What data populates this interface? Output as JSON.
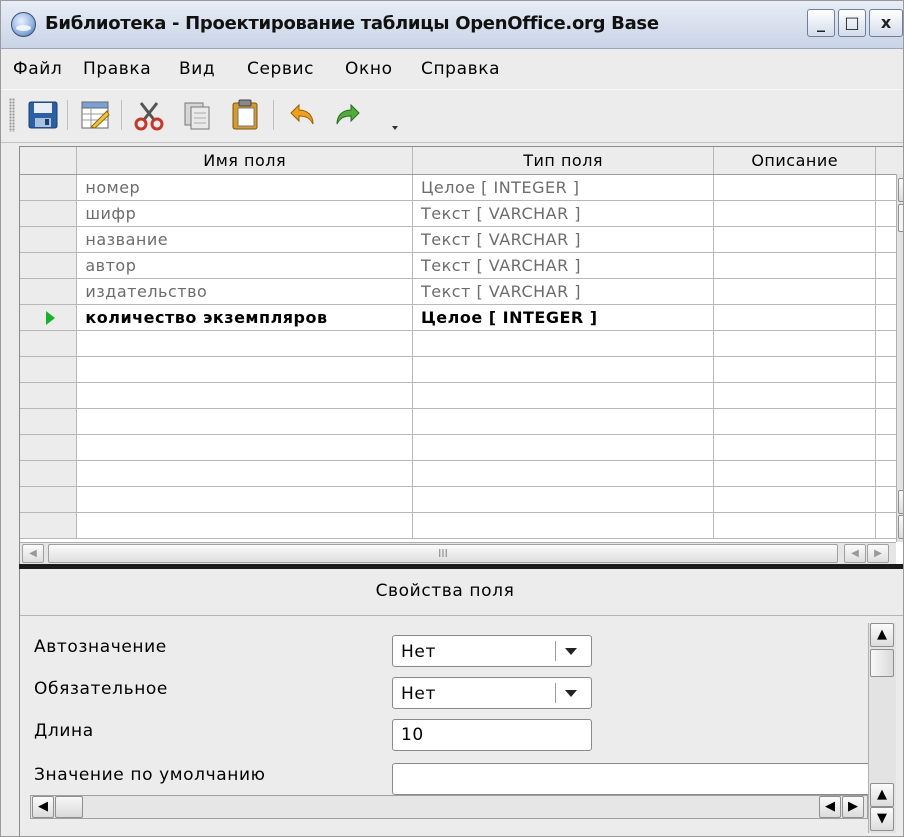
{
  "window": {
    "title": "Библиотека - Проектирование таблицы OpenOffice.org Base",
    "minimize": "_",
    "maximize": "□",
    "close": "x"
  },
  "menu": [
    {
      "label": "Файл"
    },
    {
      "label": "Правка"
    },
    {
      "label": "Вид"
    },
    {
      "label": "Сервис"
    },
    {
      "label": "Окно"
    },
    {
      "label": "Справка"
    }
  ],
  "toolbar": {
    "icons": [
      "save-icon",
      "table-design-icon",
      "cut-icon",
      "copy-icon",
      "paste-icon",
      "undo-icon",
      "redo-icon",
      "overflow-icon"
    ]
  },
  "grid": {
    "columns": [
      "Имя поля",
      "Тип поля",
      "Описание"
    ],
    "rows": [
      {
        "name": "номер",
        "type": "Целое [ INTEGER ]",
        "description": ""
      },
      {
        "name": "шифр",
        "type": "Текст [ VARCHAR ]",
        "description": ""
      },
      {
        "name": "название",
        "type": "Текст [ VARCHAR ]",
        "description": ""
      },
      {
        "name": "автор",
        "type": "Текст [ VARCHAR ]",
        "description": ""
      },
      {
        "name": "издательство",
        "type": "Текст [ VARCHAR ]",
        "description": ""
      },
      {
        "name": "количество экземпляров",
        "type": "Целое [ INTEGER ]",
        "description": ""
      }
    ],
    "current_row": 6,
    "hscroll_grip": "III"
  },
  "properties": {
    "title": "Свойства поля",
    "autovalue_label": "Автозначение",
    "autovalue_value": "Нет",
    "required_label": "Обязательное",
    "required_value": "Нет",
    "length_label": "Длина",
    "length_value": "10",
    "default_label": "Значение по умолчанию",
    "default_value": ""
  },
  "colors": {
    "current_row_marker": "#18b12b",
    "title_gradient_top": "#e8edf6",
    "title_gradient_bottom": "#c9d4e6"
  }
}
